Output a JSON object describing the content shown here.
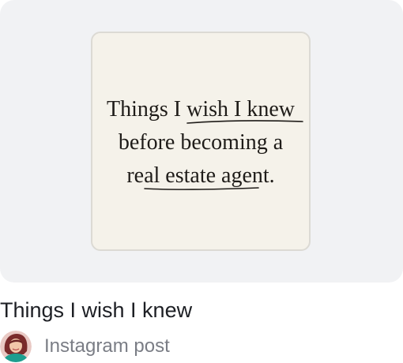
{
  "design_card": {
    "thumbnail": {
      "line1": "Things I wish I knew",
      "line2": "before becoming a",
      "line3": "real estate agent."
    },
    "title": "Things I wish I knew",
    "type_label": "Instagram post",
    "avatar_icon": "user-avatar"
  },
  "colors": {
    "preview_bg": "#f1f2f4",
    "thumb_bg": "#f5f2ea",
    "title_text": "#1d1f24",
    "meta_text": "#7a7d85"
  }
}
